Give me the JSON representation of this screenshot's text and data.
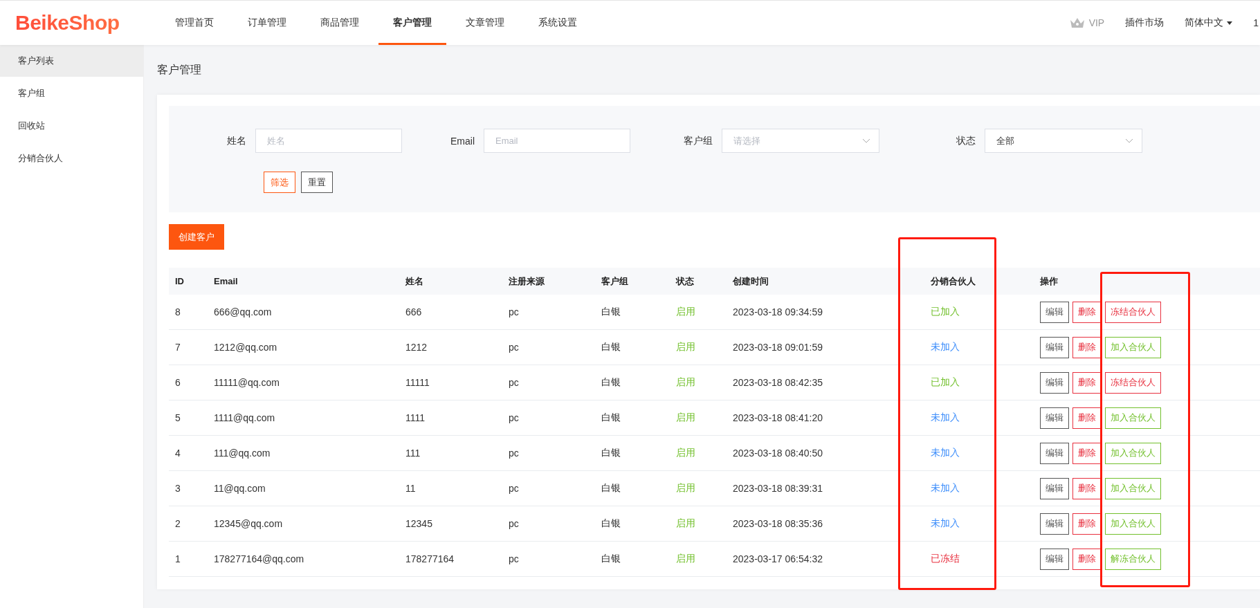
{
  "header": {
    "logo": "BeikeShop",
    "nav": [
      {
        "label": "管理首页",
        "selected": false
      },
      {
        "label": "订单管理",
        "selected": false
      },
      {
        "label": "商品管理",
        "selected": false
      },
      {
        "label": "客户管理",
        "selected": true
      },
      {
        "label": "文章管理",
        "selected": false
      },
      {
        "label": "系统设置",
        "selected": false
      }
    ],
    "vip": "VIP",
    "plugins": "插件市场",
    "language": "简体中文",
    "user": "1"
  },
  "sidebar": {
    "items": [
      {
        "label": "客户列表",
        "selected": true
      },
      {
        "label": "客户组",
        "selected": false
      },
      {
        "label": "回收站",
        "selected": false
      },
      {
        "label": "分销合伙人",
        "selected": false
      }
    ]
  },
  "page_title": "客户管理",
  "filters": {
    "fields": [
      {
        "label": "姓名",
        "kind": "input",
        "placeholder": "姓名"
      },
      {
        "label": "Email",
        "kind": "input",
        "placeholder": "Email"
      },
      {
        "label": "客户组",
        "kind": "select",
        "placeholder": "请选择"
      },
      {
        "label": "状态",
        "kind": "select",
        "value": "全部"
      }
    ],
    "buttons": [
      {
        "label": "筛选",
        "kind": "primary"
      },
      {
        "label": "重置",
        "kind": "default"
      }
    ]
  },
  "create_button": "创建客户",
  "table": {
    "columns": [
      "ID",
      "Email",
      "姓名",
      "注册来源",
      "客户组",
      "状态",
      "创建时间",
      "分销合伙人",
      "操作"
    ],
    "rows": [
      {
        "id": "8",
        "email": "666@qq.com",
        "name": "666",
        "source": "pc",
        "group": "白银",
        "status": "启用",
        "created": "2023-03-18 09:34:59",
        "partner": {
          "label": "已加入",
          "kind": "joined"
        },
        "actions": [
          {
            "label": "编辑",
            "kind": "edit"
          },
          {
            "label": "删除",
            "kind": "danger"
          },
          {
            "label": "冻结合伙人",
            "kind": "danger"
          }
        ]
      },
      {
        "id": "7",
        "email": "1212@qq.com",
        "name": "1212",
        "source": "pc",
        "group": "白银",
        "status": "启用",
        "created": "2023-03-18 09:01:59",
        "partner": {
          "label": "未加入",
          "kind": "none"
        },
        "actions": [
          {
            "label": "编辑",
            "kind": "edit"
          },
          {
            "label": "删除",
            "kind": "danger"
          },
          {
            "label": "加入合伙人",
            "kind": "success"
          }
        ]
      },
      {
        "id": "6",
        "email": "11111@qq.com",
        "name": "11111",
        "source": "pc",
        "group": "白银",
        "status": "启用",
        "created": "2023-03-18 08:42:35",
        "partner": {
          "label": "已加入",
          "kind": "joined"
        },
        "actions": [
          {
            "label": "编辑",
            "kind": "edit"
          },
          {
            "label": "删除",
            "kind": "danger"
          },
          {
            "label": "冻结合伙人",
            "kind": "danger"
          }
        ]
      },
      {
        "id": "5",
        "email": "1111@qq.com",
        "name": "1111",
        "source": "pc",
        "group": "白银",
        "status": "启用",
        "created": "2023-03-18 08:41:20",
        "partner": {
          "label": "未加入",
          "kind": "none"
        },
        "actions": [
          {
            "label": "编辑",
            "kind": "edit"
          },
          {
            "label": "删除",
            "kind": "danger"
          },
          {
            "label": "加入合伙人",
            "kind": "success"
          }
        ]
      },
      {
        "id": "4",
        "email": "111@qq.com",
        "name": "111",
        "source": "pc",
        "group": "白银",
        "status": "启用",
        "created": "2023-03-18 08:40:50",
        "partner": {
          "label": "未加入",
          "kind": "none"
        },
        "actions": [
          {
            "label": "编辑",
            "kind": "edit"
          },
          {
            "label": "删除",
            "kind": "danger"
          },
          {
            "label": "加入合伙人",
            "kind": "success"
          }
        ]
      },
      {
        "id": "3",
        "email": "11@qq.com",
        "name": "11",
        "source": "pc",
        "group": "白银",
        "status": "启用",
        "created": "2023-03-18 08:39:31",
        "partner": {
          "label": "未加入",
          "kind": "none"
        },
        "actions": [
          {
            "label": "编辑",
            "kind": "edit"
          },
          {
            "label": "删除",
            "kind": "danger"
          },
          {
            "label": "加入合伙人",
            "kind": "success"
          }
        ]
      },
      {
        "id": "2",
        "email": "12345@qq.com",
        "name": "12345",
        "source": "pc",
        "group": "白银",
        "status": "启用",
        "created": "2023-03-18 08:35:36",
        "partner": {
          "label": "未加入",
          "kind": "none"
        },
        "actions": [
          {
            "label": "编辑",
            "kind": "edit"
          },
          {
            "label": "删除",
            "kind": "danger"
          },
          {
            "label": "加入合伙人",
            "kind": "success"
          }
        ]
      },
      {
        "id": "1",
        "email": "178277164@qq.com",
        "name": "178277164",
        "source": "pc",
        "group": "白银",
        "status": "启用",
        "created": "2023-03-17 06:54:32",
        "partner": {
          "label": "已冻结",
          "kind": "frozen"
        },
        "actions": [
          {
            "label": "编辑",
            "kind": "edit"
          },
          {
            "label": "删除",
            "kind": "danger"
          },
          {
            "label": "解冻合伙人",
            "kind": "success"
          }
        ]
      }
    ]
  },
  "annotations": [
    {
      "kind": "frame"
    },
    {
      "kind": "frame"
    }
  ]
}
